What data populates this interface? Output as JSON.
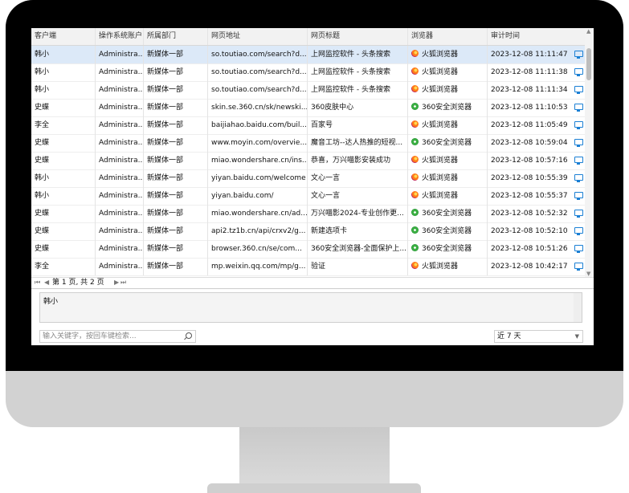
{
  "columns": [
    "客户端",
    "操作系统账户",
    "所属部门",
    "网页地址",
    "网页标题",
    "浏览器",
    "审计时间"
  ],
  "rows": [
    {
      "client": "韩小",
      "account": "Administra...",
      "dept": "新媒体一部",
      "url": "so.toutiao.com/search?d...",
      "title": "上网监控软件 - 头条搜索",
      "browser": "火狐浏览器",
      "browser_icon": "firefox-icon",
      "time": "2023-12-08 11:11:47"
    },
    {
      "client": "韩小",
      "account": "Administra...",
      "dept": "新媒体一部",
      "url": "so.toutiao.com/search?d...",
      "title": "上网监控软件 - 头条搜索",
      "browser": "火狐浏览器",
      "browser_icon": "firefox-icon",
      "time": "2023-12-08 11:11:38"
    },
    {
      "client": "韩小",
      "account": "Administra...",
      "dept": "新媒体一部",
      "url": "so.toutiao.com/search?d...",
      "title": "上网监控软件 - 头条搜索",
      "browser": "火狐浏览器",
      "browser_icon": "firefox-icon",
      "time": "2023-12-08 11:11:34"
    },
    {
      "client": "史蝶",
      "account": "Administra...",
      "dept": "新媒体一部",
      "url": "skin.se.360.cn/sk/newski...",
      "title": "360皮肤中心",
      "browser": "360安全浏览器",
      "browser_icon": "360-browser-icon",
      "time": "2023-12-08 11:10:53"
    },
    {
      "client": "李全",
      "account": "Administra...",
      "dept": "新媒体一部",
      "url": "baijiahao.baidu.com/buil...",
      "title": "百家号",
      "browser": "火狐浏览器",
      "browser_icon": "firefox-icon",
      "time": "2023-12-08 11:05:49"
    },
    {
      "client": "史蝶",
      "account": "Administra...",
      "dept": "新媒体一部",
      "url": "www.moyin.com/overvie...",
      "title": "魔音工坊--达人热推的短视...",
      "browser": "360安全浏览器",
      "browser_icon": "360-browser-icon",
      "time": "2023-12-08 10:59:04"
    },
    {
      "client": "史蝶",
      "account": "Administra...",
      "dept": "新媒体一部",
      "url": "miao.wondershare.cn/ins...",
      "title": "恭喜，万兴喵影安装成功",
      "browser": "火狐浏览器",
      "browser_icon": "firefox-icon",
      "time": "2023-12-08 10:57:16"
    },
    {
      "client": "韩小",
      "account": "Administra...",
      "dept": "新媒体一部",
      "url": "yiyan.baidu.com/welcome",
      "title": "文心一言",
      "browser": "火狐浏览器",
      "browser_icon": "firefox-icon",
      "time": "2023-12-08 10:55:39"
    },
    {
      "client": "韩小",
      "account": "Administra...",
      "dept": "新媒体一部",
      "url": "yiyan.baidu.com/",
      "title": "文心一言",
      "browser": "火狐浏览器",
      "browser_icon": "firefox-icon",
      "time": "2023-12-08 10:55:37"
    },
    {
      "client": "史蝶",
      "account": "Administra...",
      "dept": "新媒体一部",
      "url": "miao.wondershare.cn/ad...",
      "title": "万兴喵影2024-专业创作更...",
      "browser": "360安全浏览器",
      "browser_icon": "360-browser-icon",
      "time": "2023-12-08 10:52:32"
    },
    {
      "client": "史蝶",
      "account": "Administra...",
      "dept": "新媒体一部",
      "url": "api2.tz1b.cn/api/crxv2/g...",
      "title": "新建选项卡",
      "browser": "360安全浏览器",
      "browser_icon": "360-browser-icon",
      "time": "2023-12-08 10:52:10"
    },
    {
      "client": "史蝶",
      "account": "Administra...",
      "dept": "新媒体一部",
      "url": "browser.360.cn/se/com...",
      "title": "360安全浏览器-全面保护上...",
      "browser": "360安全浏览器",
      "browser_icon": "360-browser-icon",
      "time": "2023-12-08 10:51:26"
    },
    {
      "client": "李全",
      "account": "Administra...",
      "dept": "新媒体一部",
      "url": "mp.weixin.qq.com/mp/g...",
      "title": "验证",
      "browser": "火狐浏览器",
      "browser_icon": "firefox-icon",
      "time": "2023-12-08 10:42:17"
    }
  ],
  "pager": {
    "text": "第 1 页, 共 2 页"
  },
  "detail": {
    "text": "韩小"
  },
  "search": {
    "placeholder": "输入关键字，按回车键检索..."
  },
  "range": {
    "value": "近 7 天"
  },
  "colors": {
    "selected_row": "#dce9f8",
    "accent": "#1a7fd4"
  }
}
